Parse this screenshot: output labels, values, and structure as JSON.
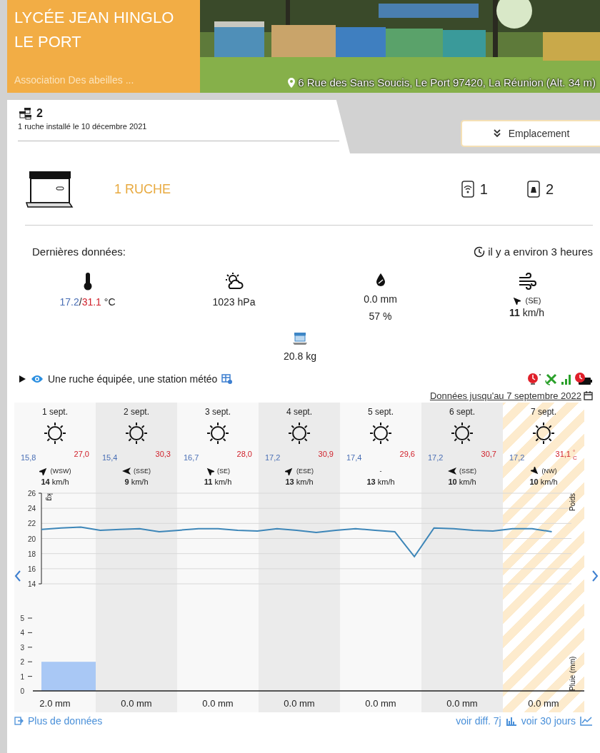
{
  "header": {
    "title": "LYCÉE JEAN HINGLO",
    "city": "LE PORT",
    "subtitle": "Association Des abeilles ...",
    "address": "6 Rue des Sans Soucis, Le Port 97420, La Réunion",
    "altitude": "(Alt. 34 m)"
  },
  "tab": {
    "count": "2",
    "installed": "1 ruche installé le 10 décembre 2021",
    "selected": true
  },
  "location_button": "Emplacement",
  "hive": {
    "label": "1 RUCHE",
    "sensors": [
      {
        "kind": "wifi",
        "count": "1"
      },
      {
        "kind": "weight",
        "count": "2"
      }
    ]
  },
  "latest": {
    "title": "Dernières données:",
    "ago": "il y a environ 3 heures",
    "temp_min": "17.2",
    "temp_sep": "/",
    "temp_max": "31.1",
    "temp_unit": "°C",
    "pressure": "1023 hPa",
    "rain": "0.0 mm",
    "humidity": "57 %",
    "wind_arrow": {
      "kind": "nw"
    },
    "wind_dir": "(SE)",
    "wind_speed": "11",
    "wind_unit": "km/h",
    "weight": "20.8 kg"
  },
  "equipment": {
    "text": "Une ruche équipée, une station météo",
    "expanded": false
  },
  "data_until": "Données jusqu'au 7 septembre 2022",
  "days": [
    {
      "date": "1 sept.",
      "min": "15,8",
      "max": "27,0",
      "arrow": {
        "kind": "ne"
      },
      "dir": "(WSW)",
      "speed": "14",
      "speed_unit": "km/h",
      "rain": "2.0 mm",
      "today": false
    },
    {
      "date": "2 sept.",
      "min": "15,4",
      "max": "30,3",
      "arrow": {
        "kind": "w"
      },
      "dir": "(SSE)",
      "speed": "9",
      "speed_unit": "km/h",
      "rain": "0.0 mm",
      "today": false
    },
    {
      "date": "3 sept.",
      "min": "16,7",
      "max": "28,0",
      "arrow": {
        "kind": "nw"
      },
      "dir": "(SE)",
      "speed": "11",
      "speed_unit": "km/h",
      "rain": "0.0 mm",
      "today": false
    },
    {
      "date": "4 sept.",
      "min": "17,2",
      "max": "30,9",
      "arrow": {
        "kind": "ne"
      },
      "dir": "(ESE)",
      "speed": "13",
      "speed_unit": "km/h",
      "rain": "0.0 mm",
      "today": false
    },
    {
      "date": "5 sept.",
      "min": "17,4",
      "max": "29,6",
      "dir": "-",
      "speed": "13",
      "speed_unit": "km/h",
      "rain": "0.0 mm",
      "today": false
    },
    {
      "date": "6 sept.",
      "min": "17,2",
      "max": "30,7",
      "arrow": {
        "kind": "w"
      },
      "dir": "(SSE)",
      "speed": "10",
      "speed_unit": "km/h",
      "rain": "0.0 mm",
      "today": false
    },
    {
      "date": "7 sept.",
      "min": "17,2",
      "max": "31,1",
      "unit": "°C",
      "arrow": {
        "kind": "se"
      },
      "dir": "(NW)",
      "speed": "10",
      "speed_unit": "km/h",
      "rain": "0.0 mm",
      "today": true
    }
  ],
  "weight_chart": {
    "chart_data": {
      "type": "line",
      "title": "Poids",
      "ylabel": "kg",
      "grid": true,
      "ylim": [
        14,
        26
      ],
      "yticks": [
        14,
        16,
        18,
        20,
        22,
        24,
        26
      ],
      "categories": [
        null,
        null,
        null,
        null,
        null,
        null,
        null,
        null,
        null,
        null,
        null,
        null,
        null,
        null,
        null,
        null,
        null,
        null,
        null,
        null,
        null,
        null,
        null,
        null,
        null,
        null,
        null
      ],
      "series": [
        {
          "color": "#3d86b8",
          "values": [
            21.2,
            21.4,
            21.5,
            21.1,
            21.2,
            21.3,
            20.9,
            21.1,
            21.3,
            21.3,
            21.1,
            21.0,
            21.3,
            21.1,
            20.8,
            21.1,
            21.3,
            21.1,
            20.9,
            17.6,
            21.4,
            21.3,
            21.1,
            21.0,
            21.3,
            21.3,
            20.9
          ]
        }
      ]
    }
  },
  "rain_chart": {
    "chart_data": {
      "type": "bar",
      "ylabel": "Pluie (mm)",
      "ylim": [
        0,
        5
      ],
      "yticks": [
        0,
        1,
        2,
        3,
        4,
        5
      ],
      "values": [
        2.0,
        0,
        0,
        0,
        0,
        0,
        0
      ]
    }
  },
  "footer": {
    "more": "Plus de données",
    "diff": "voir diff. 7j",
    "month": "voir 30 jours"
  }
}
